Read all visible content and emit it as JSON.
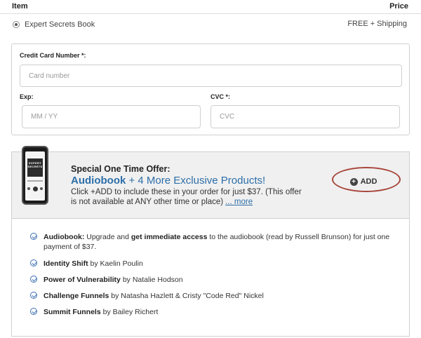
{
  "table": {
    "header_item": "Item",
    "header_price": "Price"
  },
  "product": {
    "name": "Expert Secrets Book",
    "price": "FREE + Shipping"
  },
  "payment": {
    "card_label": "Credit Card Number *:",
    "card_placeholder": "Card number",
    "exp_label": "Exp:",
    "exp_placeholder": "MM / YY",
    "cvc_label": "CVC *:",
    "cvc_placeholder": "CVC"
  },
  "offer": {
    "title": "Special One Time Offer:",
    "headline_bold": "Audiobook",
    "headline_rest": "+ 4 More Exclusive Products!",
    "description": "Click +ADD to include these in your order for just $37. (This offer is not available at ANY other time or place)",
    "more_link": "... more",
    "add_label": "ADD",
    "cover_text": "EXPERT SECRETS"
  },
  "features": [
    {
      "bold": "Audiobook:",
      "mid": "Upgrade and",
      "bold2": "get immediate access",
      "rest": "to the audiobook (read by Russell Brunson) for just one payment of $37."
    },
    {
      "bold": "Identity Shift",
      "rest": "by Kaelin Poulin"
    },
    {
      "bold": "Power of Vulnerability",
      "rest": "by Natalie Hodson"
    },
    {
      "bold": "Challenge Funnels",
      "rest": "by Natasha Hazlett & Cristy \"Code Red\" Nickel"
    },
    {
      "bold": "Summit Funnels",
      "rest": "by Bailey Richert"
    }
  ],
  "colors": {
    "accent": "#2d6ea8",
    "annotation": "#a8473c"
  }
}
